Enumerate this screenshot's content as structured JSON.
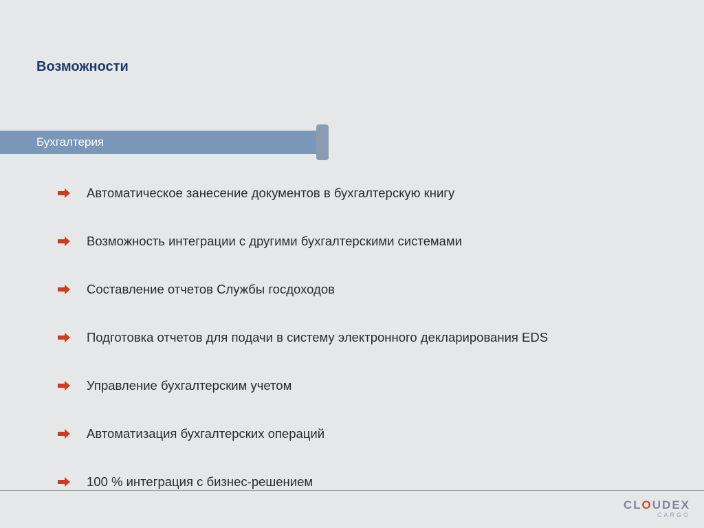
{
  "title": "Возможности",
  "section": "Бухгалтерия",
  "items": [
    "Автоматическое занесение документов в бухгалтерскую книгу",
    "Возможность интеграции с другими бухгалтерскими системами",
    "Составление отчетов Службы госдоходов",
    "Подготовка отчетов для подачи в систему электронного декларирования EDS",
    "Управление бухгалтерским учетом",
    "Автоматизация бухгалтерских операций",
    "100 % интеграция с бизнес-решением"
  ],
  "logo": {
    "main_pre": "CL",
    "main_accent": "O",
    "main_post": "UDEX",
    "sub": "CARGO"
  }
}
